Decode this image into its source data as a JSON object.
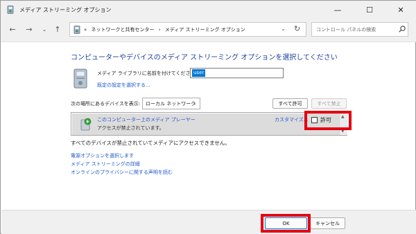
{
  "window": {
    "title": "メディア ストリーミング オプション",
    "controls": {
      "minimize": "—",
      "maximize": "☐",
      "close": "✕"
    }
  },
  "nav": {
    "back": "←",
    "forward": "→",
    "dropdown": "⌄",
    "up": "↑",
    "address_sep": "«",
    "address": [
      "ネットワークと共有センター",
      "メディア ストリーミング オプション"
    ],
    "address_chevron": "›",
    "address_dropdown": "⌄",
    "refresh": "↻",
    "search_placeholder": "コントロール パネルの検索"
  },
  "main": {
    "heading": "コンピューターやデバイスのメディア ストリーミング オプションを選択してください",
    "library_label": "メディア ライブラリに名前を付けてください:",
    "library_value": "user",
    "default_settings_link": "既定の設定を選択する...",
    "show_devices_label": "次の場所にあるデバイスを表示:",
    "location_value": "ローカル ネットワーク",
    "location_arrow": "⌄",
    "allow_all_button": "すべて許可",
    "block_all_button": "すべて禁止",
    "device": {
      "name": "このコンピューター上のメディア プレーヤー",
      "status": "アクセスが禁止されています。",
      "customize_link": "カスタマイズ...",
      "allow_label": "許可",
      "allow_checked": false
    },
    "scroll_up": "▲",
    "scroll_down": "▼",
    "blocked_message": "すべてのデバイスが禁止されていてメディアにアクセスできません。",
    "links": [
      "電源オプションを選択します",
      "メディア ストリーミングの詳細",
      "オンラインのプライバシーに関する声明を読む"
    ]
  },
  "footer": {
    "ok_button": "OK",
    "cancel_button": "キャンセル"
  },
  "colors": {
    "heading": "#1e3e9c",
    "link": "#1f57c9",
    "highlight_box": "#e60012",
    "selection": "#0078d7"
  }
}
